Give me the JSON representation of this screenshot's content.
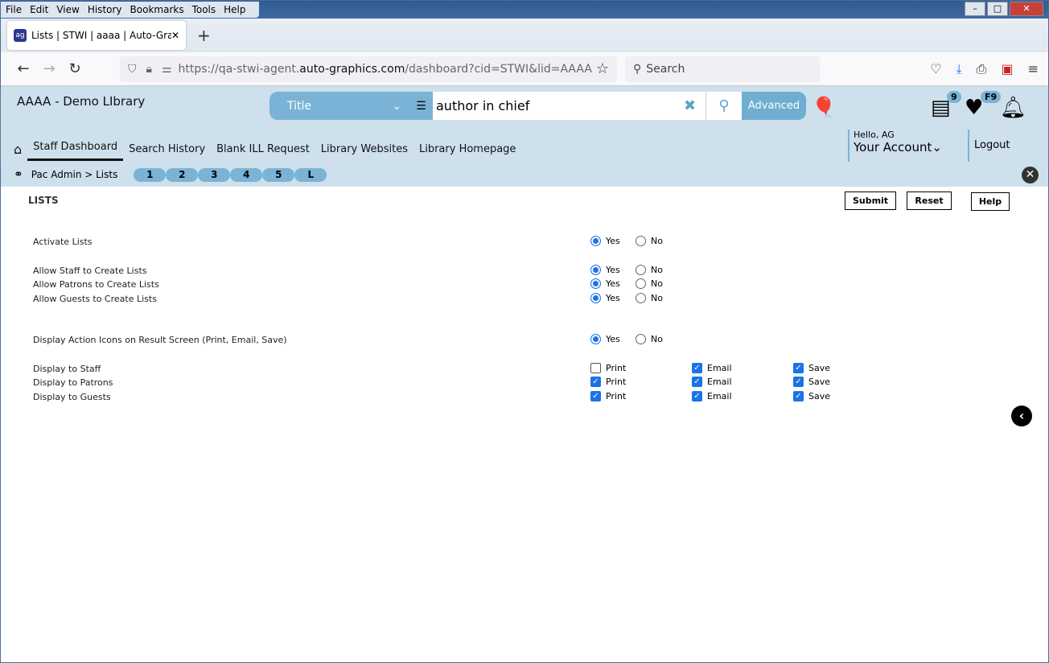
{
  "browser": {
    "menu": [
      "File",
      "Edit",
      "View",
      "History",
      "Bookmarks",
      "Tools",
      "Help"
    ],
    "tab_title": "Lists | STWI | aaaa | Auto-Graphi",
    "url_prefix": "https://qa-stwi-agent.",
    "url_domain": "auto-graphics.com",
    "url_path": "/dashboard?cid=STWI&lid=AAAA",
    "search_placeholder": "Search"
  },
  "header": {
    "library": "AAAA - Demo LIbrary",
    "search_type": "Title",
    "search_value": "author in chief",
    "advanced": "Advanced",
    "list_badge": "9",
    "fav_badge": "F9",
    "hello": "Hello, AG",
    "account": "Your Account",
    "logout": "Logout",
    "nav": [
      "Staff Dashboard",
      "Search History",
      "Blank ILL Request",
      "Library Websites",
      "Library Homepage"
    ]
  },
  "breadcrumb": {
    "text": "Pac Admin > Lists",
    "pills": [
      "1",
      "2",
      "3",
      "4",
      "5",
      "L"
    ]
  },
  "page": {
    "title": "LISTS",
    "submit": "Submit",
    "reset": "Reset",
    "help": "Help",
    "yes": "Yes",
    "no": "No",
    "radios": [
      {
        "label": "Activate Lists",
        "value": "Yes"
      },
      {
        "label": "Allow Staff to Create Lists",
        "value": "Yes"
      },
      {
        "label": "Allow Patrons to Create Lists",
        "value": "Yes"
      },
      {
        "label": "Allow Guests to Create Lists",
        "value": "Yes"
      },
      {
        "label": "Display Action Icons on Result Screen (Print, Email, Save)",
        "value": "Yes"
      }
    ],
    "checks_labels": [
      "Print",
      "Email",
      "Save"
    ],
    "checks": [
      {
        "label": "Display to Staff",
        "print": false,
        "email": true,
        "save": true
      },
      {
        "label": "Display to Patrons",
        "print": true,
        "email": true,
        "save": true
      },
      {
        "label": "Display to Guests",
        "print": true,
        "email": true,
        "save": true
      }
    ]
  },
  "colors": {
    "header_bg": "#cde0ec",
    "accent": "#7ab3d5",
    "checked": "#1a73e8"
  }
}
